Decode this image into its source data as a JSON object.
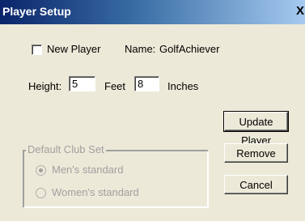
{
  "window": {
    "title": "Player Setup",
    "close_glyph": "X"
  },
  "player": {
    "new_player_label": "New Player",
    "new_player_checked": false,
    "name_label": "Name:",
    "name_value": "GolfAchiever"
  },
  "height": {
    "label": "Height:",
    "feet_value": "5",
    "feet_label": "Feet",
    "inches_value": "8",
    "inches_label": "Inches"
  },
  "club_set": {
    "legend": "Default Club Set",
    "enabled": false,
    "options": [
      {
        "label": "Men's standard",
        "selected": true
      },
      {
        "label": "Women's standard",
        "selected": false
      }
    ]
  },
  "buttons": {
    "update": "Update Player",
    "remove": "Remove",
    "cancel": "Cancel"
  }
}
